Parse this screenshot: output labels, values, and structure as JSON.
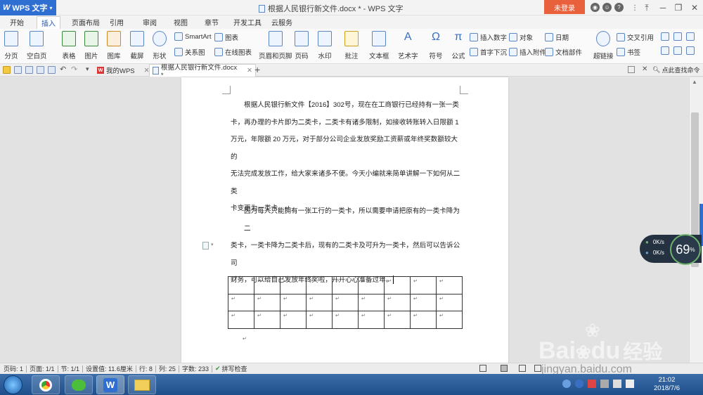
{
  "app": {
    "name": "WPS 文字",
    "window_title": "根据人民银行新文件.docx * - WPS 文字",
    "login_label": "未登录"
  },
  "menu_tabs": [
    "开始",
    "插入",
    "页面布局",
    "引用",
    "审阅",
    "视图",
    "章节",
    "开发工具",
    "云服务"
  ],
  "active_tab": "插入",
  "ribbon": {
    "page_break": "分页",
    "blank_page": "空白页",
    "table": "表格",
    "picture": "图片",
    "gallery": "图库",
    "screenshot": "截屏",
    "shape": "形状",
    "smartart": "SmartArt",
    "chart": "图表",
    "relation": "关系图",
    "online_chart": "在线图表",
    "header_footer": "页眉和页脚",
    "page_number": "页码",
    "watermark": "水印",
    "comment": "批注",
    "textbox": "文本框",
    "wordart": "艺术字",
    "symbol": "符号",
    "formula": "公式",
    "insert_number": "插入数字",
    "object": "对象",
    "date": "日期",
    "dropcap": "首字下沉",
    "attachment": "插入附件",
    "doc_part": "文档部件",
    "hyperlink": "超链接",
    "crossref": "交叉引用",
    "bookmark": "书签"
  },
  "doc_tabs": [
    {
      "label": "我的WPS"
    },
    {
      "label": "根据人民银行新文件.docx *"
    }
  ],
  "find_command": "点此查找命令",
  "document": {
    "para1": [
      "根据人民银行新文件【2016】302号，现在在工商银行已经持有一张一类",
      "卡，再办理的卡片即为二类卡，二类卡有诸多限制，如接收转账转入日限额 1",
      "万元，年限额 20 万元，对于部分公司企业发放奖励工资薪或年终奖数额较大的",
      "无法完成发放工作，给大家来诸多不便。今天小编就来简单讲解一下如何从二类",
      "卡变更为一类卡。↵"
    ],
    "para2": [
      "因为每人只能拥有一张工行的一类卡，所以需要申请把原有的一类卡降为二",
      "类卡，一类卡降为二类卡后，现有的二类卡及可升为一类卡，然后可以告诉公司",
      "财务，可以给自己发放年终奖啦，开开心心准备过年。"
    ],
    "table_rows": 3,
    "table_cols": 9,
    "cell_mark": "↵"
  },
  "status": {
    "page": "页码: 1",
    "pages": "页面: 1/1",
    "section": "节: 1/1",
    "setting": "设置值: 11.6厘米",
    "row": "行: 8",
    "col": "列: 25",
    "words": "字数: 233",
    "spell": "拼写检查"
  },
  "net_widget": {
    "up": "0K/s",
    "down": "0K/s",
    "percent": "69"
  },
  "clock": {
    "time": "21:02",
    "date": "2018/7/6"
  },
  "watermark": {
    "brand": "Bai",
    "brand2": "du",
    "brand_cn": "经验",
    "url": "jingyan.baidu.com"
  }
}
